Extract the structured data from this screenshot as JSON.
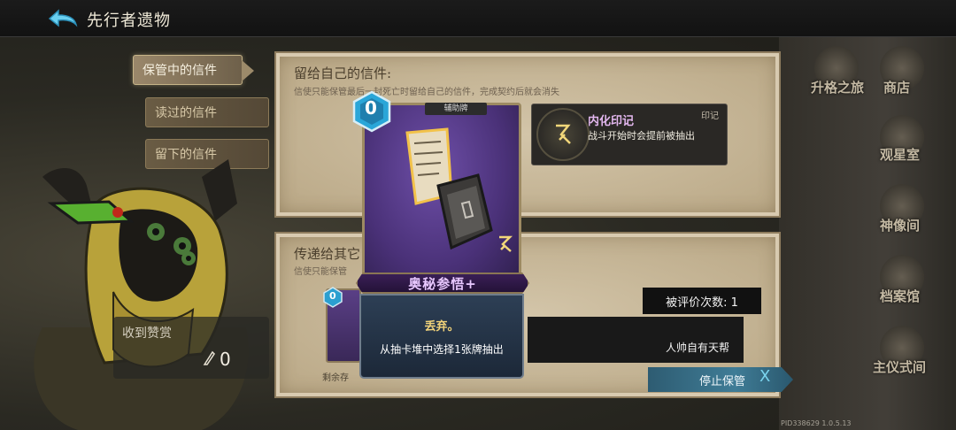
{
  "header": {
    "title": "先行者遗物"
  },
  "tabs": [
    {
      "label": "保管中的信件",
      "active": true
    },
    {
      "label": "读过的信件",
      "active": false
    },
    {
      "label": "留下的信件",
      "active": false
    }
  ],
  "reward": {
    "label": "收到赞赏",
    "count": "0"
  },
  "panel_self": {
    "title": "留给自己的信件:",
    "desc": "信使只能保管最后一封死亡时留给自己的信件，完成契约后就会消失"
  },
  "imprint": {
    "name": "内化印记",
    "tag": "印记",
    "desc": "战斗开始时会提前被抽出"
  },
  "panel_others": {
    "title": "传递给其它",
    "desc": "信使只能保管",
    "remain": "剩余存"
  },
  "card": {
    "cost": "0",
    "type": "辅助牌",
    "name": "奥秘参悟+",
    "keyword": "丢弃。",
    "desc": "从抽卡堆中选择1张牌抽出"
  },
  "mini_card": {
    "cost": "0"
  },
  "rating": {
    "label": "被评价次数: 1"
  },
  "sender": {
    "name": "人帅自有天帮"
  },
  "stop_button": {
    "label": "停止保管",
    "x": "X"
  },
  "right_nav": [
    {
      "label": "升格之旅"
    },
    {
      "label": "商店"
    },
    {
      "label": "观星室"
    },
    {
      "label": "神像间"
    },
    {
      "label": "档案馆"
    },
    {
      "label": "主仪式间"
    }
  ],
  "version": "PID338629 1.0.5.13",
  "colors": {
    "accent_blue": "#3f7c96",
    "card_purple": "#4a3178",
    "gold": "#f0d27a",
    "imprint_pink": "#e3b7ef"
  }
}
